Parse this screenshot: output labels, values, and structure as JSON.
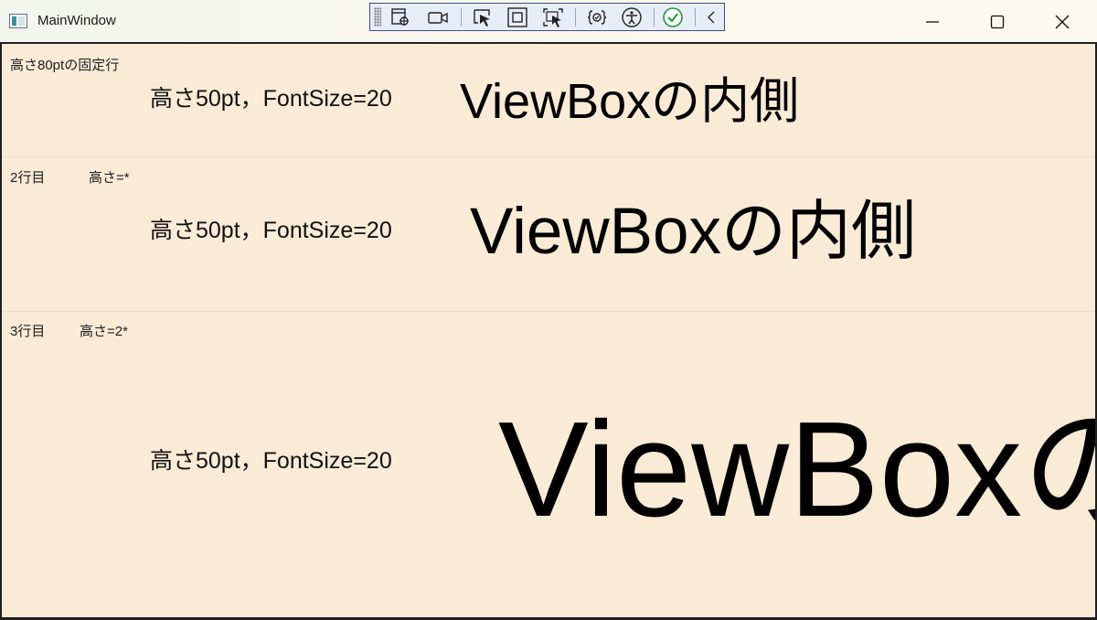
{
  "window": {
    "title": "MainWindow",
    "controls": {
      "minimize_icon": "minimize-icon",
      "maximize_icon": "maximize-icon",
      "close_icon": "close-icon"
    }
  },
  "debug_toolbar": {
    "buttons": [
      "select-element-icon",
      "record-icon",
      "element-picker-icon",
      "display-adorners-icon",
      "track-focus-icon",
      "binding-failures-icon",
      "accessibility-icon",
      "checkmark-icon",
      "collapse-icon"
    ]
  },
  "rows": [
    {
      "label_left": "高さ80ptの固定行",
      "label_right": "",
      "text_block": "高さ50pt，FontSize=20",
      "viewbox_text": "ViewBoxの内側"
    },
    {
      "label_left": "2行目",
      "label_right": "高さ=*",
      "text_block": "高さ50pt，FontSize=20",
      "viewbox_text": "ViewBoxの内側"
    },
    {
      "label_left": "3行目",
      "label_right": "高さ=2*",
      "text_block": "高さ50pt，FontSize=20",
      "viewbox_text": "ViewBoxの"
    }
  ],
  "colors": {
    "client_background": "#faebd7",
    "toolbar_background": "#e8ecf7",
    "toolbar_border": "#3e4f86"
  }
}
